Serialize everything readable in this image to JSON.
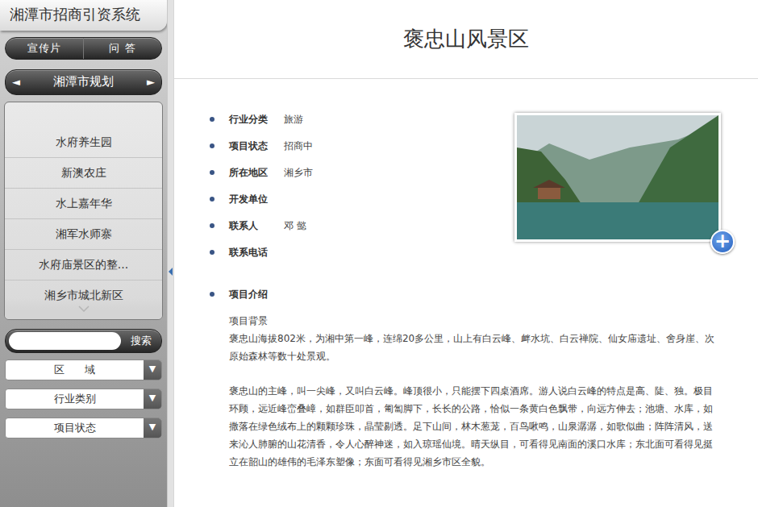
{
  "app": {
    "title": "湘潭市招商引资系统"
  },
  "toolbar": [
    {
      "label": "宣传片"
    },
    {
      "label": "问 答"
    }
  ],
  "region_nav": {
    "prev": "◄",
    "label": "湘潭市规划",
    "next": "►"
  },
  "project_list": [
    {
      "label": "水府养生园"
    },
    {
      "label": "新澳农庄"
    },
    {
      "label": "水上嘉年华"
    },
    {
      "label": "湘军水师寨"
    },
    {
      "label": "水府庙景区的整..."
    },
    {
      "label": "湘乡市城北新区"
    }
  ],
  "search": {
    "placeholder": "",
    "button": "搜索"
  },
  "filters": [
    {
      "label": "区      域",
      "arrow": "▼"
    },
    {
      "label": "行业类别",
      "arrow": "▼"
    },
    {
      "label": "项目状态",
      "arrow": "▼"
    }
  ],
  "detail": {
    "title": "褒忠山风景区",
    "fields": [
      {
        "label": "行业分类",
        "value": "旅游"
      },
      {
        "label": "项目状态",
        "value": "招商中"
      },
      {
        "label": "所在地区",
        "value": "湘乡市"
      },
      {
        "label": "开发单位"
      },
      {
        "label": "联系人",
        "value": "邓 懿"
      },
      {
        "label": "联系电话"
      }
    ],
    "photo_button": "+",
    "intro_label": "项目介绍",
    "intro_subtitle": "项目背景",
    "intro_paragraphs": [
      "褒忠山海拔802米，为湘中第一峰，连绵20多公里，山上有白云峰、衅水坑、白云禅院、仙女庙遗址、舍身崖、次原始森林等数十处景观。",
      "褒忠山的主峰，叫一尖峰，又叫白云峰。峰顶很小，只能摆下四桌酒席。游人说白云峰的特点是高、陡、独。极目环顾，远近峰峦叠嶂，如群臣叩首，匍匐脚下，长长的公路，恰似一条黄白色飘带，向远方伸去；池塘、水库，如撒落在绿色绒布上的颗颗珍珠，晶莹剔透。足下山间，林木葱茏，百鸟啾鸣，山泉潺潺，如歌似曲；阵阵清风，送来沁人肺腑的山花清香，令人心醉神迷，如入琼瑶仙境。晴天纵目，可看得见南面的溪口水库；东北面可看得见挺立在韶山的雄伟的毛泽东塑像；东面可看得见湘乡市区全貌。"
    ]
  }
}
